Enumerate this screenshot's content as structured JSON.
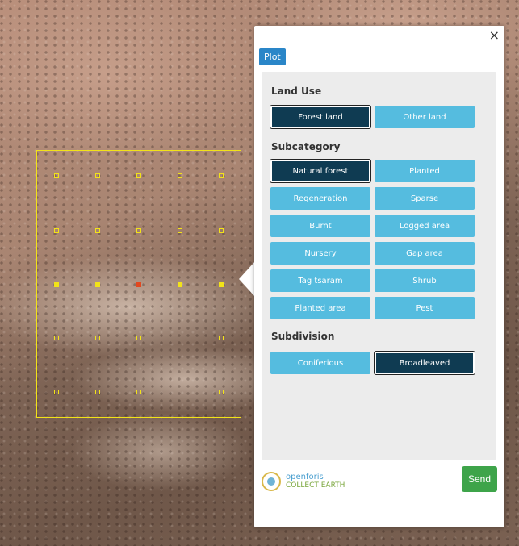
{
  "panel": {
    "close_label": "×",
    "tab_label": "Plot",
    "land_use": {
      "label": "Land Use",
      "options": [
        {
          "label": "Forest land",
          "selected": true
        },
        {
          "label": "Other land",
          "selected": false
        }
      ]
    },
    "subcategory": {
      "label": "Subcategory",
      "options": [
        {
          "label": "Natural forest",
          "selected": true
        },
        {
          "label": "Planted",
          "selected": false
        },
        {
          "label": "Regeneration",
          "selected": false
        },
        {
          "label": "Sparse",
          "selected": false
        },
        {
          "label": "Burnt",
          "selected": false
        },
        {
          "label": "Logged area",
          "selected": false
        },
        {
          "label": "Nursery",
          "selected": false
        },
        {
          "label": "Gap area",
          "selected": false
        },
        {
          "label": "Tag tsaram",
          "selected": false
        },
        {
          "label": "Shrub",
          "selected": false
        },
        {
          "label": "Planted area",
          "selected": false
        },
        {
          "label": "Pest",
          "selected": false
        }
      ]
    },
    "subdivision": {
      "label": "Subdivision",
      "options": [
        {
          "label": "Coniferious",
          "selected": false
        },
        {
          "label": "Broadleaved",
          "selected": true
        }
      ]
    },
    "logo": {
      "top": "openforis",
      "bottom": "COLLECT EARTH"
    },
    "send_label": "Send"
  },
  "colors": {
    "option_default": "#55bcdf",
    "option_selected": "#0f3b52",
    "send": "#3ea44a",
    "plot_tab": "#2a86c8",
    "plot_outline": "#f2e318",
    "highlighted_point": "#e2481f"
  }
}
